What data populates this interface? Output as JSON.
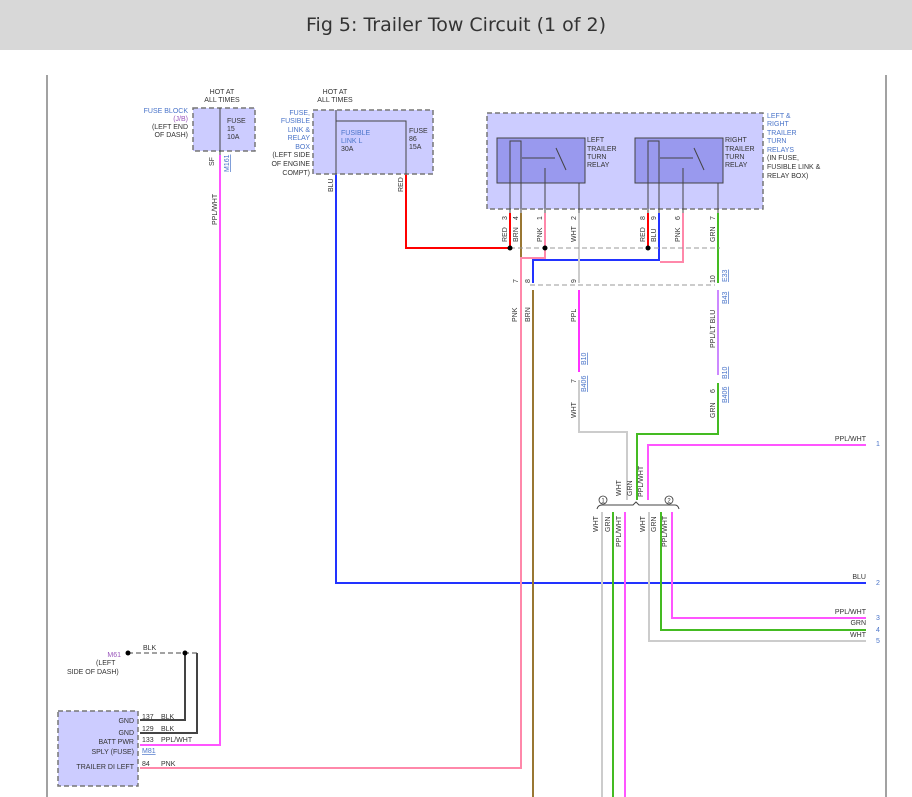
{
  "title": "Fig 5: Trailer Tow Circuit (1 of 2)",
  "colors": {
    "RED": "#ff0000",
    "BLU": "#2233ff",
    "PNK": "#ff88aa",
    "BRN": "#997733",
    "WHT": "#cccccc",
    "GRN": "#44bb22",
    "PPL": "#ff33ff",
    "PPL_LT_BLU": "#cc88ff",
    "PPL_WHT": "#ff55ff",
    "BLK": "#444444",
    "box": "#ccccff",
    "relay": "#9999ee"
  },
  "fuse_block": {
    "hot": [
      "HOT AT",
      "ALL TIMES"
    ],
    "name": [
      "FUSE BLOCK",
      "(J/B)"
    ],
    "loc": [
      "(LEFT END",
      "OF DASH)"
    ],
    "fuse": [
      "FUSE",
      "15",
      "10A"
    ],
    "pin": "SF",
    "conn": "M161",
    "wire": "PPL/WHT"
  },
  "fuse_box": {
    "hot": [
      "HOT AT",
      "ALL TIMES"
    ],
    "name": [
      "FUSE,",
      "FUSIBLE",
      "LINK &",
      "RELAY",
      "BOX"
    ],
    "loc": [
      "(LEFT SIDE",
      "OF ENGINE",
      "COMPT)"
    ],
    "link": [
      "FUSIBLE",
      "LINK L",
      "30A"
    ],
    "fuse": [
      "FUSE",
      "86",
      "15A"
    ],
    "wires": [
      "BLU",
      "RED"
    ]
  },
  "relay_box": {
    "label": [
      "LEFT &",
      "RIGHT",
      "TRAILER",
      "TURN",
      "RELAYS",
      "(IN FUSE,",
      "FUSIBLE LINK &",
      "RELAY BOX)"
    ],
    "left_relay": [
      "LEFT",
      "TRAILER",
      "TURN",
      "RELAY"
    ],
    "right_relay": [
      "RIGHT",
      "TRAILER",
      "TURN",
      "RELAY"
    ],
    "pins": [
      {
        "wire": "RED",
        "pin": "3"
      },
      {
        "wire": "BRN",
        "pin": "4"
      },
      {
        "wire": "PNK",
        "pin": "1"
      },
      {
        "wire": "WHT",
        "pin": "2"
      },
      {
        "wire": "RED",
        "pin": "8"
      },
      {
        "wire": "BLU",
        "pin": "9"
      },
      {
        "wire": "PNK",
        "pin": "6"
      },
      {
        "wire": "GRN",
        "pin": "7"
      }
    ]
  },
  "connectors": {
    "c7": "7",
    "c8": "8",
    "c9": "9",
    "c10": "10",
    "e33": "E33",
    "b43": "B43",
    "pnk": "PNK",
    "brn": "BRN",
    "ppl": "PPL",
    "ppl_lt_blu": "PPL/LT BLU",
    "b10a": "B10",
    "b406a": "B406",
    "p7": "7",
    "wht": "WHT",
    "b10b": "B10",
    "b406b": "B406",
    "p6": "6",
    "grn": "GRN"
  },
  "splice": {
    "one": "1",
    "two": "2",
    "in": [
      "WHT",
      "GRN",
      "PPL/WHT"
    ],
    "out1": [
      "WHT",
      "GRN",
      "PPL/WHT"
    ],
    "out2": [
      "WHT",
      "GRN",
      "PPL/WHT"
    ]
  },
  "outputs": [
    {
      "wire": "PPL/WHT",
      "pin": "1"
    },
    {
      "wire": "BLU",
      "pin": "2"
    },
    {
      "wire": "PPL/WHT",
      "pin": "3"
    },
    {
      "wire": "GRN",
      "pin": "4"
    },
    {
      "wire": "WHT",
      "pin": "5"
    }
  ],
  "ground": {
    "conn": "M61",
    "loc": [
      "(LEFT",
      "SIDE OF DASH)"
    ],
    "wire": "BLK"
  },
  "module": {
    "rows": [
      {
        "label": "GND",
        "pin": "137",
        "wire": "BLK"
      },
      {
        "label": "GND",
        "pin": "129",
        "wire": "BLK"
      },
      {
        "label": "BATT PWR",
        "pin": "133",
        "wire": "PPL/WHT"
      },
      {
        "label": "SPLY (FUSE)",
        "pin": "M81",
        "wire": ""
      },
      {
        "label": "TRAILER DI LEFT",
        "pin": "84",
        "wire": "PNK"
      }
    ]
  }
}
